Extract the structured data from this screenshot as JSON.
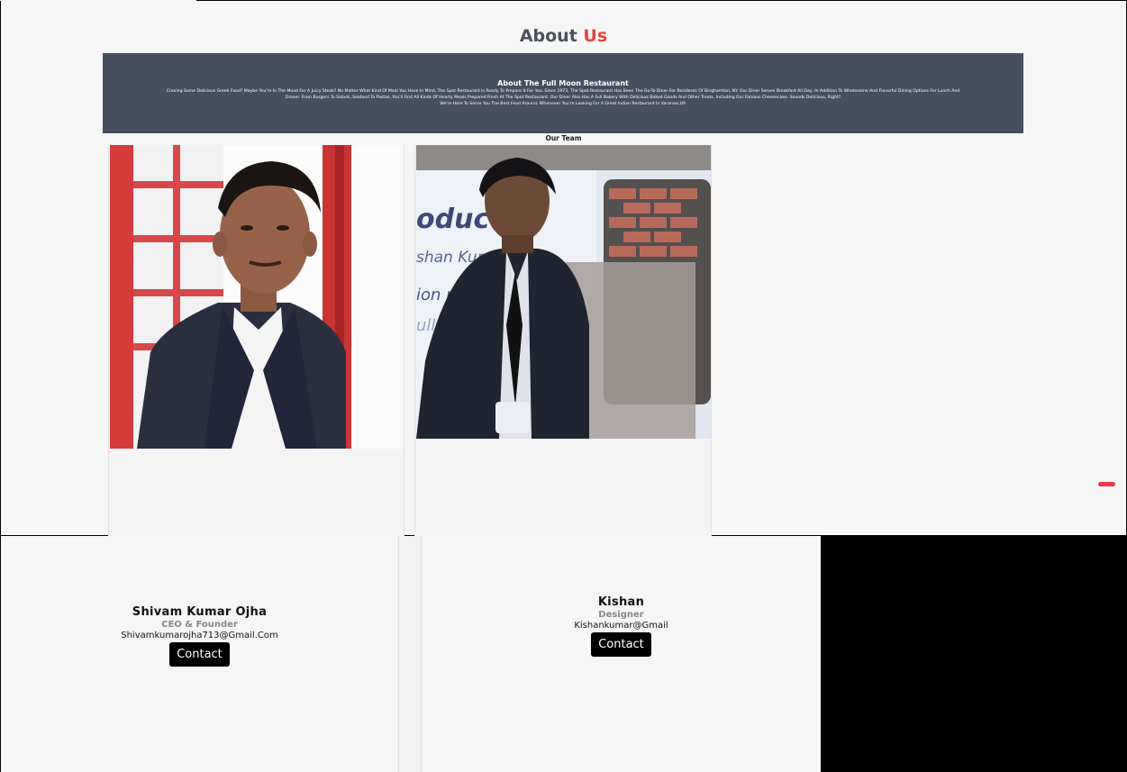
{
  "heading": {
    "part1": "About ",
    "part2": "Us"
  },
  "banner": {
    "title": "About The Full Moon Restaurant",
    "text_line1": "Craving Some Delicious Greek Food? Maybe You're In The Mood For A Juicy Steak? No Matter What Kind Of Meal You Have In Mind, The Spot Restaurant Is Ready To Prepare It For You. Since 1973, The Spot Restaurant Has Been The Go-To Diner For Residents Of Binghamton, NY. Our Diner Serves Breakfast All Day, In Addition To Wholesome And Flavorful Dining Options For Lunch And",
    "text_line2": "Dinner. From Burgers To Salads, Seafood To Pastas, You'll Find All Kinds Of Hearty Meals Prepared Fresh At The Spot Restaurant. Our Diner Also Has A Full Bakery With Delicious Baked Goods And Other Treats, Including Our Famous Cheesecake. Sounds Delicious, Right?",
    "text_line3": "We're Here To Serve You The Best Food Around, Whenever You're Looking For A Great Indian Restaurant In Varanasi,UP."
  },
  "team_label": "Our Team",
  "members": [
    {
      "name": "Shivam Kumar Ojha",
      "role": "CEO & Founder",
      "email": "Shivamkumarojha713@Gmail.Com",
      "contact_label": "Contact"
    },
    {
      "name": "Kishan",
      "role": "Designer",
      "email": "Kishankumar@Gmail",
      "contact_label": "Contact"
    }
  ],
  "colors": {
    "accent": "#e8443d",
    "banner_bg": "#474f5e",
    "button_bg": "#000000"
  }
}
